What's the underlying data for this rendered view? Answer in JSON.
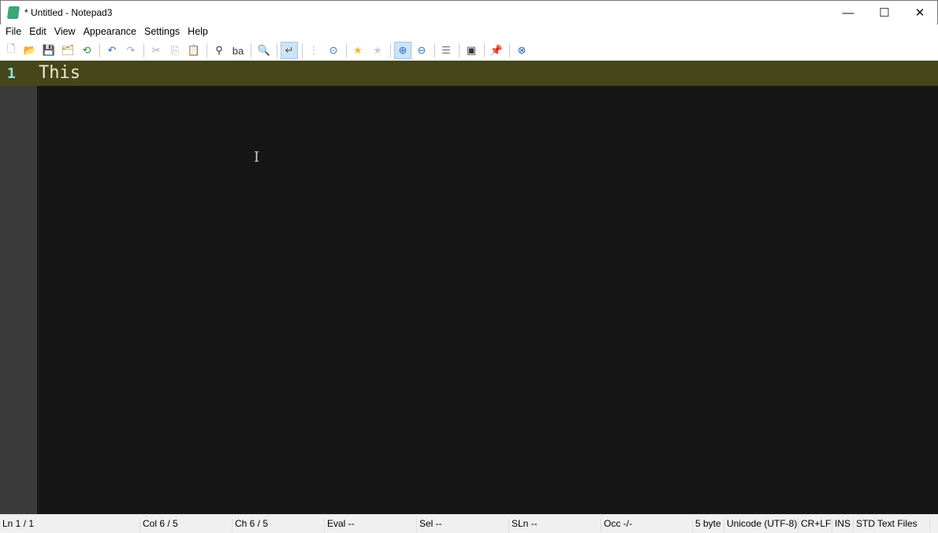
{
  "window": {
    "title": "* Untitled - Notepad3",
    "minimize": "—",
    "maximize": "☐",
    "close": "✕"
  },
  "menu": [
    "File",
    "Edit",
    "View",
    "Appearance",
    "Settings",
    "Help"
  ],
  "toolbar": [
    {
      "name": "new-file-icon",
      "glyph": "🗋",
      "color": "#888"
    },
    {
      "name": "open-folder-icon",
      "glyph": "📂",
      "color": "#d9a53a"
    },
    {
      "name": "save-icon",
      "glyph": "💾",
      "color": "#8a3fa0"
    },
    {
      "name": "save-as-icon",
      "glyph": "🗂",
      "color": "#b08a40"
    },
    {
      "name": "revert-icon",
      "glyph": "⟲",
      "color": "#2a8a2a"
    },
    {
      "name": "undo-icon",
      "glyph": "↶",
      "color": "#2a6fc0"
    },
    {
      "name": "redo-icon",
      "glyph": "↷",
      "color": "#aaa"
    },
    {
      "name": "cut-icon",
      "glyph": "✂",
      "color": "#aaa"
    },
    {
      "name": "copy-icon",
      "glyph": "⎘",
      "color": "#aaa"
    },
    {
      "name": "paste-icon",
      "glyph": "📋",
      "color": "#a0522d"
    },
    {
      "name": "find-icon",
      "glyph": "⚲",
      "color": "#333"
    },
    {
      "name": "replace-icon",
      "glyph": "ba",
      "color": "#333"
    },
    {
      "name": "goto-icon",
      "glyph": "🔍",
      "color": "#777"
    },
    {
      "name": "word-wrap-icon",
      "glyph": "↵",
      "color": "#555"
    },
    {
      "name": "long-line-icon",
      "glyph": "⋮",
      "color": "#bbb"
    },
    {
      "name": "zoom-reset-icon",
      "glyph": "⊙",
      "color": "#2a6fc0"
    },
    {
      "name": "favorite-icon",
      "glyph": "★",
      "color": "#e8c020"
    },
    {
      "name": "add-favorite-icon",
      "glyph": "★",
      "color": "#ccc"
    },
    {
      "name": "zoom-in-icon",
      "glyph": "⊕",
      "color": "#2a6fc0"
    },
    {
      "name": "zoom-out-icon",
      "glyph": "⊖",
      "color": "#2a6fc0"
    },
    {
      "name": "scheme-icon",
      "glyph": "☰",
      "color": "#777"
    },
    {
      "name": "console-icon",
      "glyph": "▣",
      "color": "#333"
    },
    {
      "name": "pin-icon",
      "glyph": "📌",
      "color": "#2a6fc0"
    },
    {
      "name": "exit-icon",
      "glyph": "⊗",
      "color": "#2a5fb0"
    }
  ],
  "editor": {
    "line_number": "1",
    "text": "This"
  },
  "status": [
    "Ln 1 / 1",
    "Col  6 / 5",
    "Ch  6 / 5",
    "Eval  --",
    "Sel  --",
    "SLn  --",
    "Occ  -/-",
    "5 byte",
    "Unicode (UTF-8)",
    "CR+LF",
    "INS",
    "STD",
    "Text Files"
  ]
}
